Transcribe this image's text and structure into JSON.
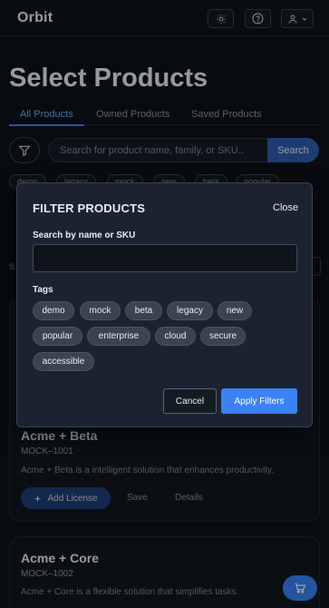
{
  "app": {
    "brand": "Orbit"
  },
  "header": {
    "icons": {
      "theme": "sun-icon",
      "help": "help-icon",
      "account": "user-icon"
    }
  },
  "page": {
    "title": "Select Products"
  },
  "tabs": [
    {
      "label": "All Products",
      "active": true
    },
    {
      "label": "Owned Products",
      "active": false
    },
    {
      "label": "Saved Products",
      "active": false
    }
  ],
  "search": {
    "placeholder": "Search for product name, family, or SKU..",
    "button_label": "Search"
  },
  "background_chips": [
    "demo",
    "legacy",
    "mock",
    "new",
    "beta",
    "popular"
  ],
  "sort_label": "S",
  "products": [
    {
      "name": "Acme + Beta",
      "sku": "MOCK–1001",
      "description": "Acme + Beta is a intelligent solution that enhances productivity.",
      "add_label": "Add License",
      "save_label": "Save",
      "details_label": "Details"
    },
    {
      "name": "Acme + Core",
      "sku": "MOCK–1002",
      "description": "Acme + Core is a flexible solution that simplifies tasks."
    }
  ],
  "modal": {
    "title": "FILTER PRODUCTS",
    "close_label": "Close",
    "search_label": "Search by name or SKU",
    "search_value": "",
    "tags_label": "Tags",
    "tags": [
      "demo",
      "mock",
      "beta",
      "legacy",
      "new",
      "popular",
      "enterprise",
      "cloud",
      "secure",
      "accessible"
    ],
    "cancel_label": "Cancel",
    "apply_label": "Apply Filters"
  },
  "colors": {
    "accent": "#3b82f6",
    "background": "#0d1117",
    "modal": "#1c2330"
  }
}
